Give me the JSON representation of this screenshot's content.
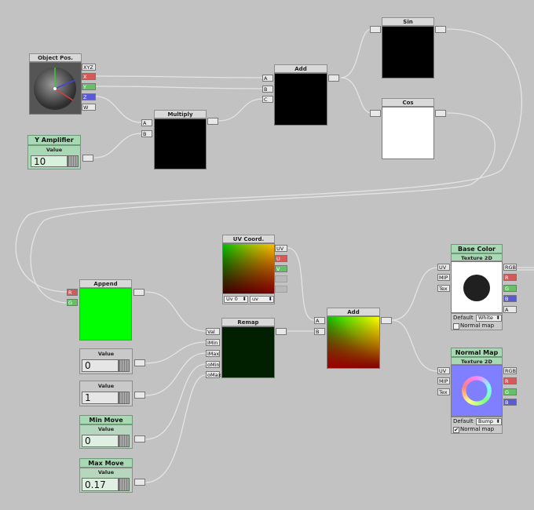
{
  "object_pos": {
    "title": "Object Pos.",
    "outputs": [
      "XYZ",
      "X",
      "Y",
      "Z",
      "W"
    ]
  },
  "sin": {
    "title": "Sin"
  },
  "cos": {
    "title": "Cos"
  },
  "add_top": {
    "title": "Add",
    "inputs": [
      "A",
      "B",
      "C"
    ]
  },
  "multiply": {
    "title": "Multiply",
    "inputs": [
      "A",
      "B"
    ]
  },
  "y_amplifier": {
    "title": "Y Amplifier",
    "label": "Value",
    "value": "10"
  },
  "uv_coord": {
    "title": "UV Coord.",
    "outputs": [
      "UV",
      "U",
      "V",
      "",
      ""
    ],
    "channel_select": "Uv 0",
    "mode_select": "uv"
  },
  "append": {
    "title": "Append",
    "inputs": [
      "R",
      "G"
    ]
  },
  "remap": {
    "title": "Remap",
    "inputs": [
      "Val",
      "iMin",
      "iMax",
      "oMin",
      "oMax"
    ]
  },
  "add_bottom": {
    "title": "Add",
    "inputs": [
      "A",
      "B"
    ]
  },
  "value_0": {
    "label": "Value",
    "value": "0"
  },
  "value_1": {
    "label": "Value",
    "value": "1"
  },
  "min_move": {
    "title": "Min Move",
    "label": "Value",
    "value": "0"
  },
  "max_move": {
    "title": "Max Move",
    "label": "Value",
    "value": "0.17"
  },
  "base_color": {
    "title": "Base Color",
    "subtitle": "Texture 2D",
    "inputs": [
      "UV",
      "MIP",
      "Tex"
    ],
    "outputs": [
      "RGB",
      "R",
      "G",
      "B",
      "A"
    ],
    "default_label": "Default",
    "default_value": "White",
    "normal_map_label": "Normal map",
    "normal_map_checked": false
  },
  "normal_map": {
    "title": "Normal Map",
    "subtitle": "Texture 2D",
    "inputs": [
      "UV",
      "MIP",
      "Tex"
    ],
    "outputs": [
      "RGB",
      "R",
      "G",
      "B"
    ],
    "default_label": "Default",
    "default_value": "Bump",
    "normal_map_label": "Normal map",
    "normal_map_checked": true,
    "check_mark": "✔"
  },
  "colors": {
    "canvas": "#c2c2c2",
    "wire": "#e4e4e4",
    "value_green": "#a9d8b4",
    "port_red": "#d45a5a",
    "port_green": "#67c067",
    "port_blue": "#5a5ad8",
    "append_fill": "#00ff00",
    "remap_fill": "#002000"
  }
}
